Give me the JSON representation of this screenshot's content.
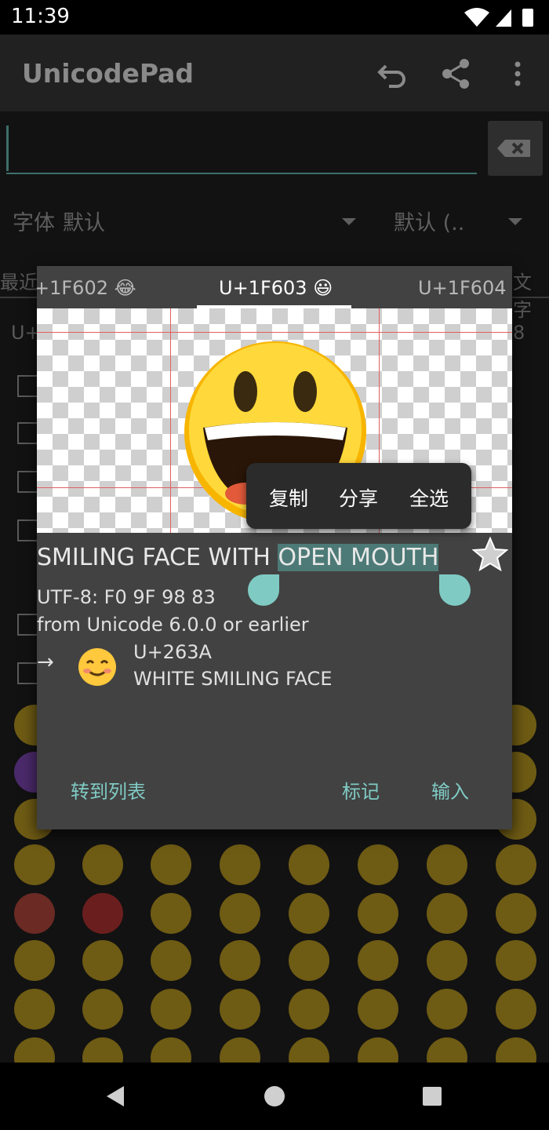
{
  "status": {
    "time": "11:39"
  },
  "app": {
    "title": "UnicodePad"
  },
  "toolbar": {
    "undo": "undo-icon",
    "share": "share-icon",
    "more": "more-vert-icon"
  },
  "font_row": {
    "font_label": "字体",
    "font_value": "默认",
    "locale_value": "默认 (.."
  },
  "bg": {
    "tab_left": "最近",
    "tab_right": "文字",
    "row_prefix": "U+",
    "row_suffix": "8"
  },
  "dialog": {
    "tabs": [
      {
        "label": "+1F602 😂"
      },
      {
        "label": "U+1F603 😃"
      },
      {
        "label": "U+1F604 😄"
      }
    ],
    "name_plain": "SMILING FACE WITH ",
    "name_selected": "OPEN MOUTH",
    "utf8": "UTF-8: F0 9F 98 83",
    "version": "from Unicode 6.0.0 or earlier",
    "related": {
      "arrow": "→",
      "code": "U+263A",
      "name": "WHITE SMILING FACE"
    },
    "buttons": {
      "go_to_list": "转到列表",
      "mark": "标记",
      "input": "输入"
    }
  },
  "context_menu": {
    "copy": "复制",
    "share": "分享",
    "select_all": "全选"
  },
  "colors": {
    "accent": "#80cbc4",
    "selection": "#4d7a76",
    "dialog_bg": "#424242"
  }
}
